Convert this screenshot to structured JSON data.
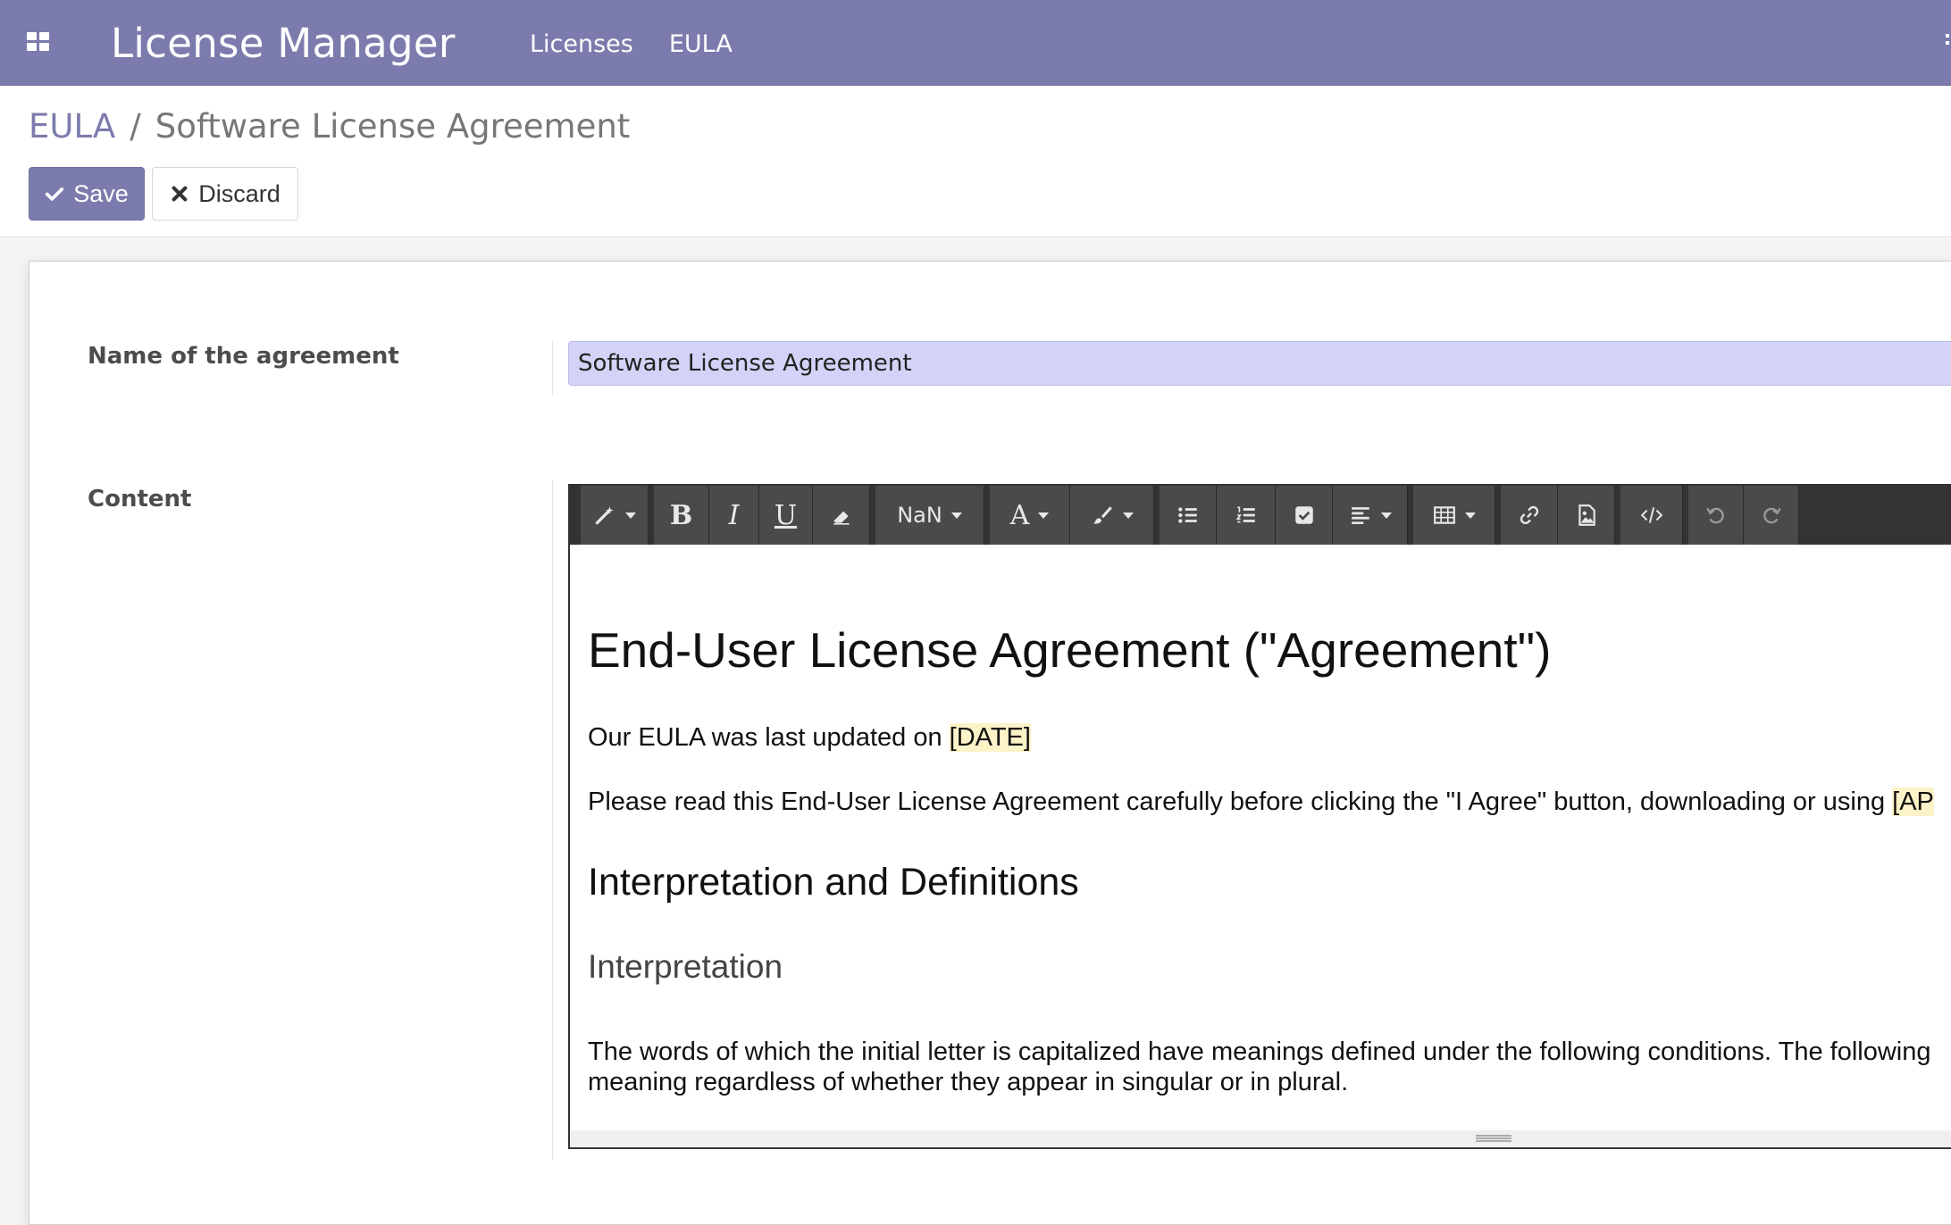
{
  "navbar": {
    "app_title": "License Manager",
    "menu": [
      {
        "label": "Licenses"
      },
      {
        "label": "EULA"
      }
    ],
    "accent_color": "#7c7bad"
  },
  "breadcrumb": {
    "parent": "EULA",
    "separator": "/",
    "current": "Software License Agreement"
  },
  "actions": {
    "save_label": "Save",
    "discard_label": "Discard"
  },
  "form": {
    "name_label": "Name of the agreement",
    "name_value": "Software License Agreement",
    "content_label": "Content"
  },
  "toolbar": {
    "font_size_value": "NaN",
    "icons": [
      "magic-wand-icon",
      "bold-icon",
      "italic-icon",
      "underline-icon",
      "eraser-icon",
      "font-size-dropdown",
      "font-color-icon",
      "paintbrush-icon",
      "unordered-list-icon",
      "ordered-list-icon",
      "checklist-icon",
      "align-icon",
      "table-icon",
      "link-icon",
      "image-icon",
      "code-view-icon",
      "undo-icon",
      "redo-icon"
    ]
  },
  "document": {
    "heading": "End-User License Agreement (\"Agreement\")",
    "updated_prefix": "Our EULA was last updated on ",
    "updated_placeholder": "[DATE]",
    "please_text": "Please read this End-User License Agreement carefully before clicking the \"I Agree\" button, downloading or using ",
    "please_placeholder": "[AP",
    "section_heading": "Interpretation and Definitions",
    "subsection_heading": "Interpretation",
    "para_line1": "The words of which the initial letter is capitalized have meanings defined under the following conditions. The following",
    "para_line2": "meaning regardless of whether they appear in singular or in plural."
  }
}
